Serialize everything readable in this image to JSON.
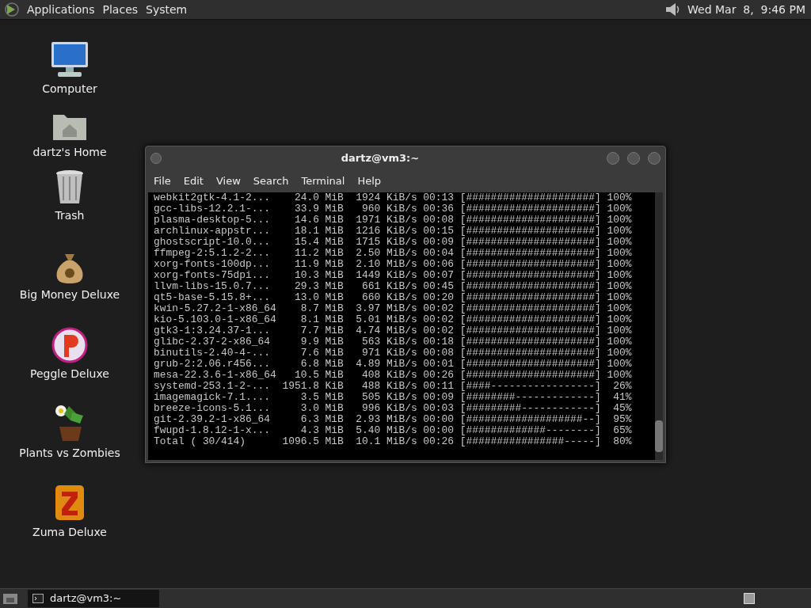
{
  "top_panel": {
    "menus": [
      "Applications",
      "Places",
      "System"
    ],
    "clock": "Wed Mar  8,  9:46 PM"
  },
  "desktop_icons": [
    {
      "kind": "computer",
      "label": "Computer"
    },
    {
      "kind": "home",
      "label": "dartz's Home"
    },
    {
      "kind": "trash",
      "label": "Trash"
    },
    {
      "kind": "money",
      "label": "Big Money Deluxe"
    },
    {
      "kind": "peggle",
      "label": "Peggle Deluxe"
    },
    {
      "kind": "plants",
      "label": "Plants vs Zombies"
    },
    {
      "kind": "zuma",
      "label": "Zuma Deluxe"
    }
  ],
  "terminal": {
    "title": "dartz@vm3:~",
    "menu": [
      "File",
      "Edit",
      "View",
      "Search",
      "Terminal",
      "Help"
    ],
    "lines": [
      {
        "name": "webkit2gtk-4.1-2...",
        "size": "24.0 MiB",
        "rate": "1924 KiB/s",
        "eta": "00:13",
        "bar": "[#####################]",
        "percent": "100%"
      },
      {
        "name": "gcc-libs-12.2.1-...",
        "size": "33.9 MiB",
        "rate": "960 KiB/s",
        "eta": "00:36",
        "bar": "[#####################]",
        "percent": "100%"
      },
      {
        "name": "plasma-desktop-5...",
        "size": "14.6 MiB",
        "rate": "1971 KiB/s",
        "eta": "00:08",
        "bar": "[#####################]",
        "percent": "100%"
      },
      {
        "name": "archlinux-appstr...",
        "size": "18.1 MiB",
        "rate": "1216 KiB/s",
        "eta": "00:15",
        "bar": "[#####################]",
        "percent": "100%"
      },
      {
        "name": "ghostscript-10.0...",
        "size": "15.4 MiB",
        "rate": "1715 KiB/s",
        "eta": "00:09",
        "bar": "[#####################]",
        "percent": "100%"
      },
      {
        "name": "ffmpeg-2:5.1.2-2...",
        "size": "11.2 MiB",
        "rate": "2.50 MiB/s",
        "eta": "00:04",
        "bar": "[#####################]",
        "percent": "100%"
      },
      {
        "name": "xorg-fonts-100dp...",
        "size": "11.9 MiB",
        "rate": "2.10 MiB/s",
        "eta": "00:06",
        "bar": "[#####################]",
        "percent": "100%"
      },
      {
        "name": "xorg-fonts-75dpi...",
        "size": "10.3 MiB",
        "rate": "1449 KiB/s",
        "eta": "00:07",
        "bar": "[#####################]",
        "percent": "100%"
      },
      {
        "name": "llvm-libs-15.0.7...",
        "size": "29.3 MiB",
        "rate": "661 KiB/s",
        "eta": "00:45",
        "bar": "[#####################]",
        "percent": "100%"
      },
      {
        "name": "qt5-base-5.15.8+...",
        "size": "13.0 MiB",
        "rate": "660 KiB/s",
        "eta": "00:20",
        "bar": "[#####################]",
        "percent": "100%"
      },
      {
        "name": "kwin-5.27.2-1-x86_64",
        "size": "8.7 MiB",
        "rate": "3.97 MiB/s",
        "eta": "00:02",
        "bar": "[#####################]",
        "percent": "100%"
      },
      {
        "name": "kio-5.103.0-1-x86_64",
        "size": "8.1 MiB",
        "rate": "5.01 MiB/s",
        "eta": "00:02",
        "bar": "[#####################]",
        "percent": "100%"
      },
      {
        "name": "gtk3-1:3.24.37-1...",
        "size": "7.7 MiB",
        "rate": "4.74 MiB/s",
        "eta": "00:02",
        "bar": "[#####################]",
        "percent": "100%"
      },
      {
        "name": "glibc-2.37-2-x86_64",
        "size": "9.9 MiB",
        "rate": "563 KiB/s",
        "eta": "00:18",
        "bar": "[#####################]",
        "percent": "100%"
      },
      {
        "name": "binutils-2.40-4-...",
        "size": "7.6 MiB",
        "rate": "971 KiB/s",
        "eta": "00:08",
        "bar": "[#####################]",
        "percent": "100%"
      },
      {
        "name": "grub-2:2.06.r456...",
        "size": "6.8 MiB",
        "rate": "4.89 MiB/s",
        "eta": "00:01",
        "bar": "[#####################]",
        "percent": "100%"
      },
      {
        "name": "mesa-22.3.6-1-x86_64",
        "size": "10.5 MiB",
        "rate": "408 KiB/s",
        "eta": "00:26",
        "bar": "[#####################]",
        "percent": "100%"
      },
      {
        "name": "systemd-253.1-2-...",
        "size": "1951.8 KiB",
        "rate": "488 KiB/s",
        "eta": "00:11",
        "bar": "[####-----------------]",
        "percent": "26%"
      },
      {
        "name": "imagemagick-7.1....",
        "size": "3.5 MiB",
        "rate": "505 KiB/s",
        "eta": "00:09",
        "bar": "[########-------------]",
        "percent": "41%"
      },
      {
        "name": "breeze-icons-5.1...",
        "size": "3.0 MiB",
        "rate": "996 KiB/s",
        "eta": "00:03",
        "bar": "[#########------------]",
        "percent": "45%"
      },
      {
        "name": "git-2.39.2-1-x86_64",
        "size": "6.3 MiB",
        "rate": "2.93 MiB/s",
        "eta": "00:00",
        "bar": "[###################--]",
        "percent": "95%"
      },
      {
        "name": "fwupd-1.8.12-1-x...",
        "size": "4.3 MiB",
        "rate": "5.40 MiB/s",
        "eta": "00:00",
        "bar": "[#############--------]",
        "percent": "65%"
      },
      {
        "name": "Total ( 30/414)",
        "size": "1096.5 MiB",
        "rate": "10.1 MiB/s",
        "eta": "00:26",
        "bar": "[################-----]",
        "percent": "80%"
      }
    ]
  },
  "taskbar": {
    "tasks": [
      {
        "label": "dartz@vm3:~",
        "selected": true
      }
    ]
  }
}
